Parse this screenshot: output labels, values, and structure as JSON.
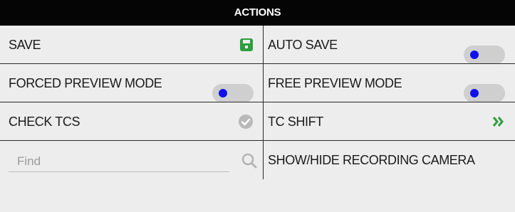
{
  "header": {
    "title": "ACTIONS"
  },
  "actions": {
    "save": {
      "label": "SAVE",
      "icon": "floppy-disk-icon",
      "icon_color": "#2e9e3e"
    },
    "auto_save": {
      "label": "AUTO SAVE",
      "enabled": false
    },
    "forced_preview": {
      "label": "FORCED PREVIEW MODE",
      "enabled": false
    },
    "free_preview": {
      "label": "FREE PREVIEW MODE",
      "enabled": false
    },
    "check_tcs": {
      "label": "CHECK TCS",
      "icon": "check-circle-icon",
      "icon_color": "#b8b8b8"
    },
    "tc_shift": {
      "label": "TC SHIFT",
      "icon": "double-chevron-right-icon",
      "icon_color": "#2e9e3e"
    },
    "find": {
      "placeholder": "Find",
      "value": "",
      "icon": "search-icon"
    },
    "show_hide_camera": {
      "label": "SHOW/HIDE RECORDING CAMERA"
    }
  },
  "colors": {
    "header_bg": "#050505",
    "panel_bg": "#ededed",
    "toggle_track": "#cfcfcf",
    "toggle_knob": "#1010ee",
    "accent_green": "#2e9e3e"
  }
}
